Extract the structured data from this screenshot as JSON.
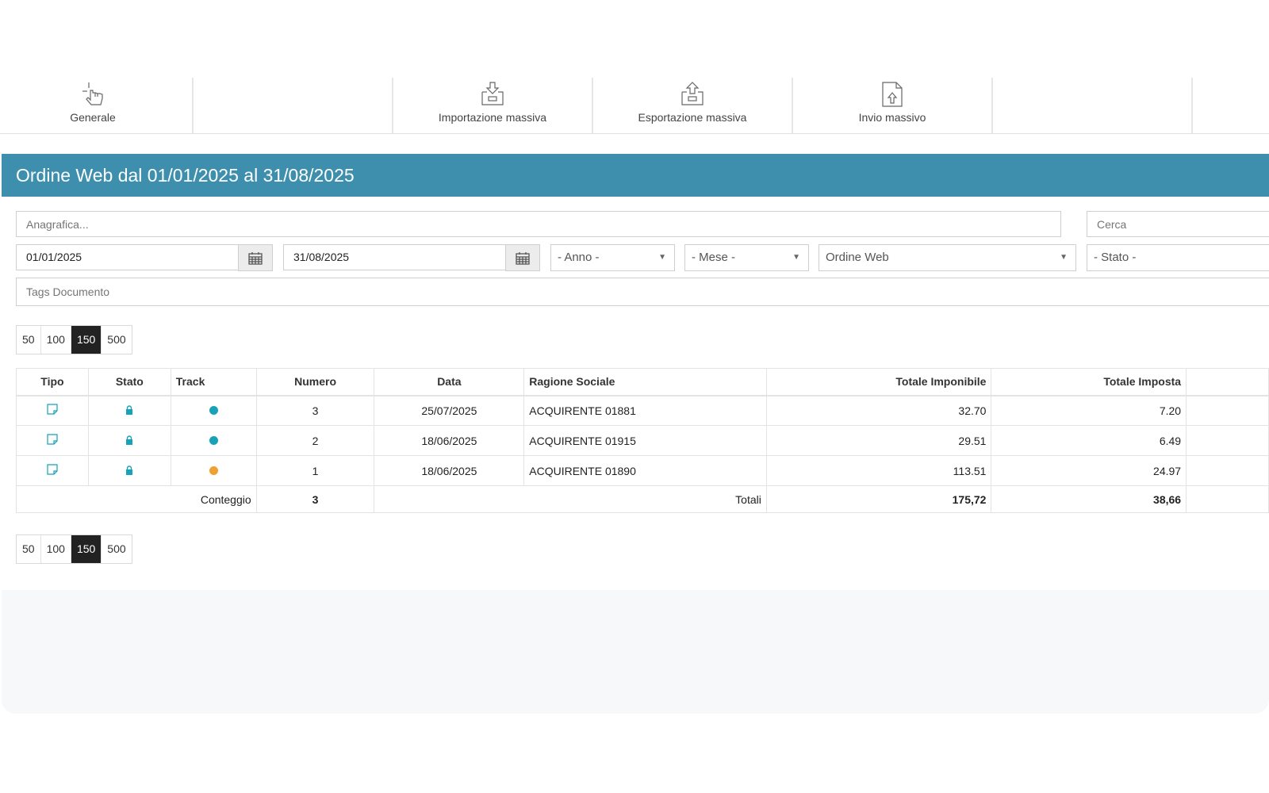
{
  "toolbar": {
    "items": [
      {
        "label": "Generale",
        "icon": "hand-pointer-icon"
      },
      {
        "label": "",
        "icon": ""
      },
      {
        "label": "Importazione massiva",
        "icon": "tray-import-icon"
      },
      {
        "label": "Esportazione massiva",
        "icon": "tray-export-icon"
      },
      {
        "label": "Invio massivo",
        "icon": "document-upload-icon"
      },
      {
        "label": "",
        "icon": ""
      }
    ]
  },
  "header": {
    "title": "Ordine Web dal 01/01/2025 al 31/08/2025",
    "color": "#3d8fad"
  },
  "filters": {
    "anagrafica_placeholder": "Anagrafica...",
    "cerca_placeholder": "Cerca",
    "date_from": "01/01/2025",
    "date_to": "31/08/2025",
    "anno": "- Anno -",
    "mese": "- Mese -",
    "tipo_documento": "Ordine Web",
    "stato": "- Stato -",
    "tags_placeholder": "Tags Documento"
  },
  "pager": {
    "options": [
      "50",
      "100",
      "150",
      "500"
    ],
    "selected": "150"
  },
  "table": {
    "headers": {
      "tipo": "Tipo",
      "stato": "Stato",
      "track": "Track",
      "numero": "Numero",
      "data": "Data",
      "ragione": "Ragione Sociale",
      "imponibile": "Totale Imponibile",
      "imposta": "Totale Imposta"
    },
    "rows": [
      {
        "numero": "3",
        "data": "25/07/2025",
        "ragione": "ACQUIRENTE 01881",
        "imponibile": "32.70",
        "imposta": "7.20",
        "track_color": "#17a2b8"
      },
      {
        "numero": "2",
        "data": "18/06/2025",
        "ragione": "ACQUIRENTE 01915",
        "imponibile": "29.51",
        "imposta": "6.49",
        "track_color": "#17a2b8"
      },
      {
        "numero": "1",
        "data": "18/06/2025",
        "ragione": "ACQUIRENTE 01890",
        "imponibile": "113.51",
        "imposta": "24.97",
        "track_color": "#f0a030"
      }
    ],
    "footer": {
      "conteggio_label": "Conteggio",
      "conteggio": "3",
      "totali_label": "Totali",
      "tot_imponibile": "175,72",
      "tot_imposta": "38,66"
    }
  },
  "colors": {
    "accent": "#17a2b8",
    "header": "#3d8fad",
    "pager_active": "#222222"
  }
}
